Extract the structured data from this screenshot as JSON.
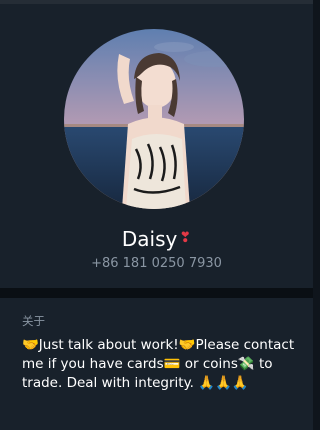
{
  "profile": {
    "name": "Daisy",
    "name_badge": "❣",
    "phone": "+86 181 0250 7930"
  },
  "about": {
    "label": "关于",
    "bio": "🤝Just talk about work!🤝Please contact me if you have cards💳 or coins💸 to trade. Deal with integrity. 🙏🙏🙏"
  },
  "colors": {
    "background": "#0f151c",
    "panel": "#18212b",
    "secondary_text": "#8a96a3",
    "badge": "#e53946"
  }
}
